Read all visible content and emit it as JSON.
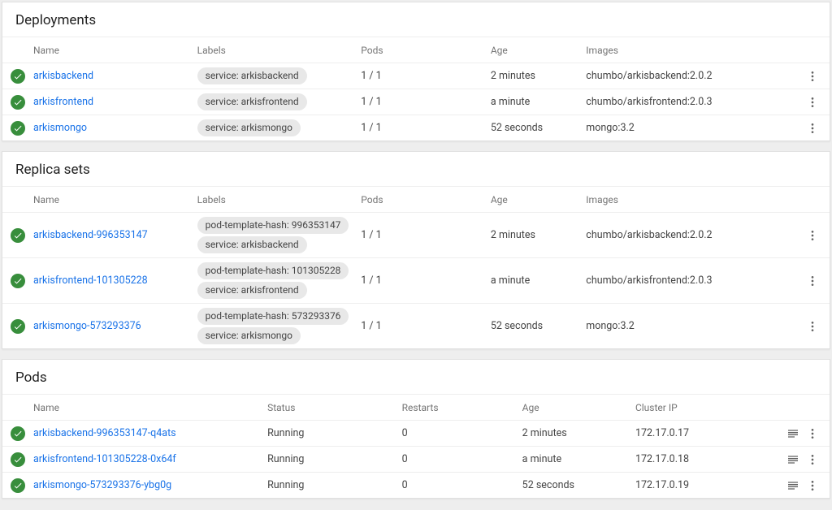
{
  "sections": {
    "deployments": {
      "title": "Deployments",
      "headers": {
        "name": "Name",
        "labels": "Labels",
        "pods": "Pods",
        "age": "Age",
        "images": "Images"
      }
    },
    "replicasets": {
      "title": "Replica sets",
      "headers": {
        "name": "Name",
        "labels": "Labels",
        "pods": "Pods",
        "age": "Age",
        "images": "Images"
      }
    },
    "pods": {
      "title": "Pods",
      "headers": {
        "name": "Name",
        "status": "Status",
        "restarts": "Restarts",
        "age": "Age",
        "clusterip": "Cluster IP"
      }
    }
  },
  "deployments": [
    {
      "name": "arkisbackend",
      "labels": [
        "service: arkisbackend"
      ],
      "pods": "1 / 1",
      "age": "2 minutes",
      "images": "chumbo/arkisbackend:2.0.2"
    },
    {
      "name": "arkisfrontend",
      "labels": [
        "service: arkisfrontend"
      ],
      "pods": "1 / 1",
      "age": "a minute",
      "images": "chumbo/arkisfrontend:2.0.3"
    },
    {
      "name": "arkismongo",
      "labels": [
        "service: arkismongo"
      ],
      "pods": "1 / 1",
      "age": "52 seconds",
      "images": "mongo:3.2"
    }
  ],
  "replicasets": [
    {
      "name": "arkisbackend-996353147",
      "labels": [
        "pod-template-hash: 996353147",
        "service: arkisbackend"
      ],
      "pods": "1 / 1",
      "age": "2 minutes",
      "images": "chumbo/arkisbackend:2.0.2"
    },
    {
      "name": "arkisfrontend-101305228",
      "labels": [
        "pod-template-hash: 101305228",
        "service: arkisfrontend"
      ],
      "pods": "1 / 1",
      "age": "a minute",
      "images": "chumbo/arkisfrontend:2.0.3"
    },
    {
      "name": "arkismongo-573293376",
      "labels": [
        "pod-template-hash: 573293376",
        "service: arkismongo"
      ],
      "pods": "1 / 1",
      "age": "52 seconds",
      "images": "mongo:3.2"
    }
  ],
  "pods": [
    {
      "name": "arkisbackend-996353147-q4ats",
      "status": "Running",
      "restarts": "0",
      "age": "2 minutes",
      "clusterip": "172.17.0.17"
    },
    {
      "name": "arkisfrontend-101305228-0x64f",
      "status": "Running",
      "restarts": "0",
      "age": "a minute",
      "clusterip": "172.17.0.18"
    },
    {
      "name": "arkismongo-573293376-ybg0g",
      "status": "Running",
      "restarts": "0",
      "age": "52 seconds",
      "clusterip": "172.17.0.19"
    }
  ]
}
